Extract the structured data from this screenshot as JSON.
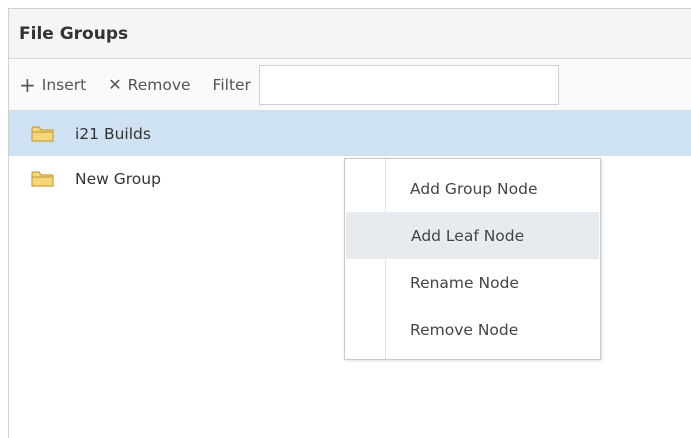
{
  "panel": {
    "title": "File Groups"
  },
  "toolbar": {
    "insert_label": "Insert",
    "insert_icon": "plus-icon",
    "remove_label": "Remove",
    "remove_icon": "close-icon",
    "filter_label": "Filter",
    "filter_value": ""
  },
  "tree": {
    "nodes": [
      {
        "label": "i21 Builds",
        "icon": "folder-icon",
        "selected": true
      },
      {
        "label": "New Group",
        "icon": "folder-icon",
        "selected": false
      }
    ]
  },
  "context_menu": {
    "items": [
      {
        "label": "Add Group Node"
      },
      {
        "label": "Add Leaf Node",
        "hovered": true
      },
      {
        "label": "Rename Node"
      },
      {
        "label": "Remove Node"
      }
    ]
  },
  "colors": {
    "selected_row": "#cfe2f3",
    "folder_fill": "#f5d67a",
    "folder_stroke": "#c9a23a",
    "menu_hover": "#e6ebef"
  }
}
